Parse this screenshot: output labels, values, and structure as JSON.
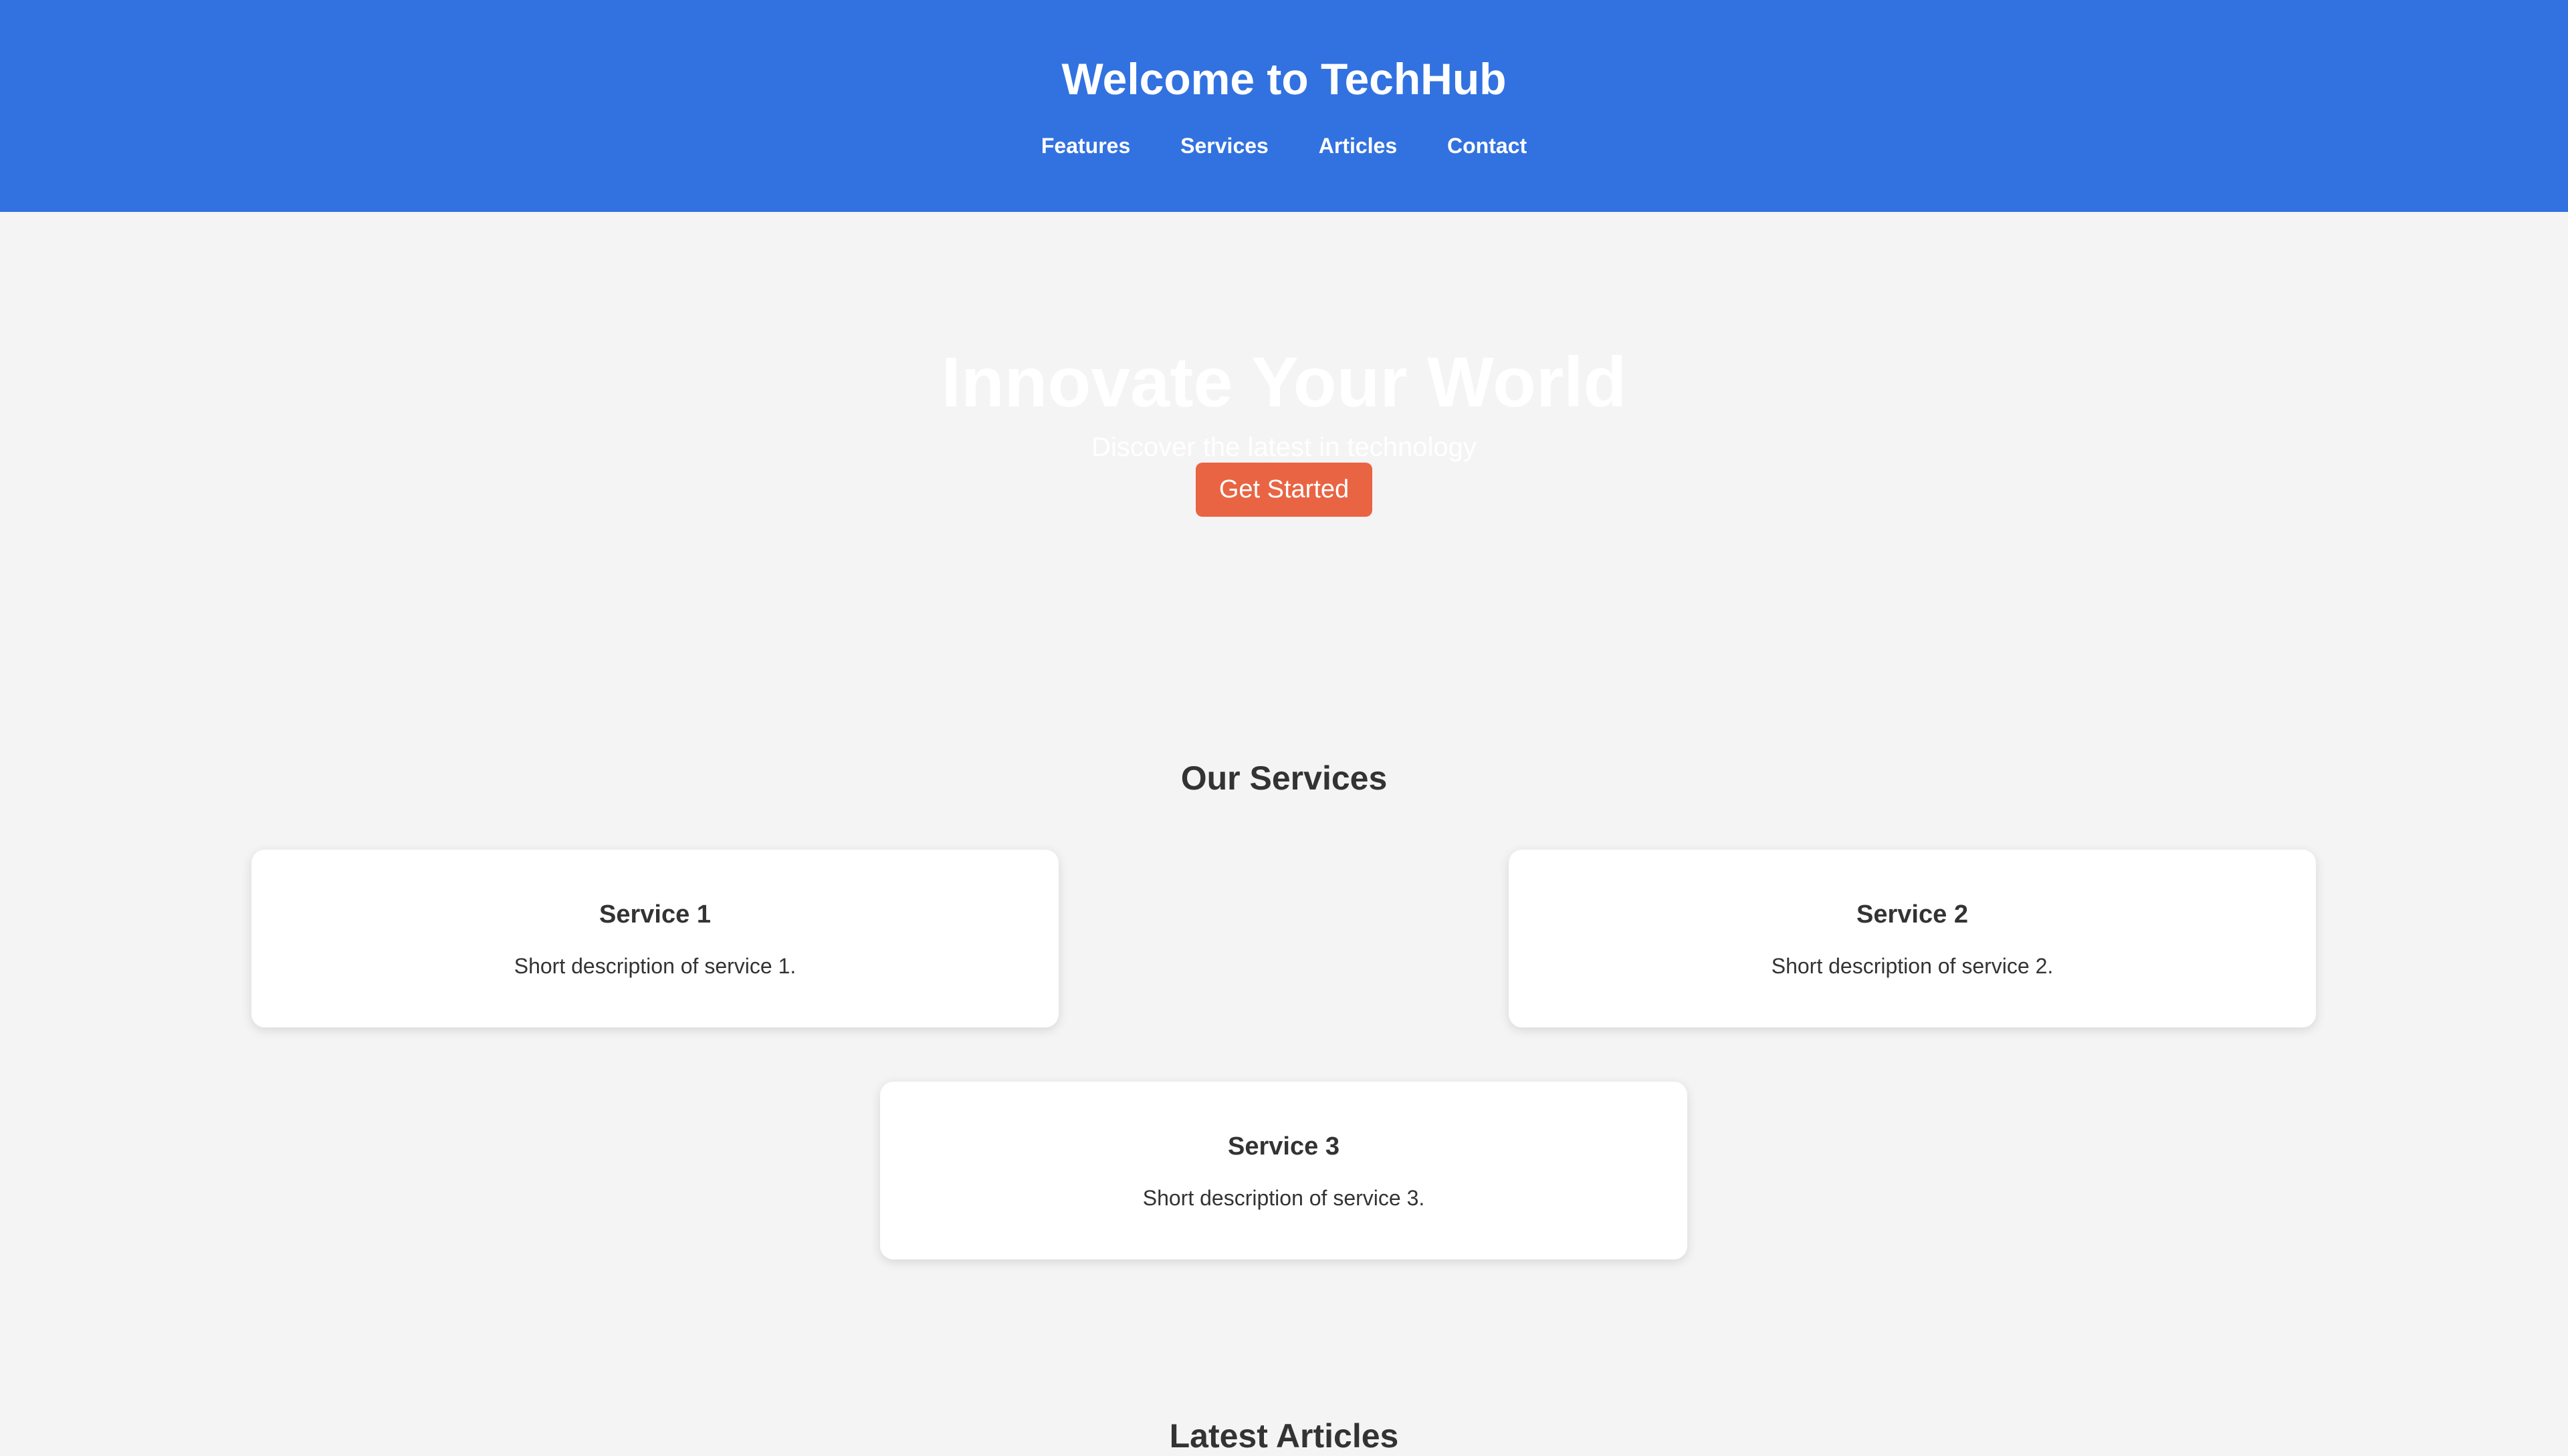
{
  "header": {
    "title": "Welcome to TechHub",
    "nav": [
      "Features",
      "Services",
      "Articles",
      "Contact"
    ]
  },
  "hero": {
    "title": "Innovate Your World",
    "subtitle": "Discover the latest in technology",
    "cta_label": "Get Started"
  },
  "services": {
    "heading": "Our Services",
    "items": [
      {
        "title": "Service 1",
        "description": "Short description of service 1."
      },
      {
        "title": "Service 2",
        "description": "Short description of service 2."
      },
      {
        "title": "Service 3",
        "description": "Short description of service 3."
      }
    ]
  },
  "articles": {
    "heading": "Latest Articles"
  },
  "colors": {
    "header_bg": "#3272e0",
    "page_bg": "#f4f4f4",
    "cta_bg": "#e96443",
    "card_bg": "#ffffff",
    "text": "#333333"
  }
}
